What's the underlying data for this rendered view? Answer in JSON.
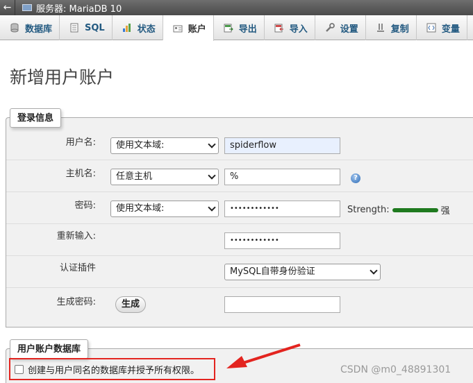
{
  "server_bar": {
    "back": "←",
    "label": "服务器: MariaDB 10"
  },
  "tabs": [
    {
      "label": "数据库",
      "icon": "database-icon",
      "active": false
    },
    {
      "label": "SQL",
      "icon": "sql-icon",
      "active": false
    },
    {
      "label": "状态",
      "icon": "status-icon",
      "active": false
    },
    {
      "label": "账户",
      "icon": "accounts-icon",
      "active": true
    },
    {
      "label": "导出",
      "icon": "export-icon",
      "active": false
    },
    {
      "label": "导入",
      "icon": "import-icon",
      "active": false
    },
    {
      "label": "设置",
      "icon": "settings-icon",
      "active": false
    },
    {
      "label": "复制",
      "icon": "replication-icon",
      "active": false
    },
    {
      "label": "变量",
      "icon": "variables-icon",
      "active": false
    }
  ],
  "page_title": "新增用户账户",
  "login_info": {
    "legend": "登录信息",
    "username": {
      "label": "用户名:",
      "mode": "使用文本域:",
      "value": "spiderflow"
    },
    "host": {
      "label": "主机名:",
      "mode": "任意主机",
      "value": "%"
    },
    "password": {
      "label": "密码:",
      "mode": "使用文本域:",
      "value": "••••••••••••",
      "strength_label": "Strength:",
      "strength_value": "强"
    },
    "retype": {
      "label": "重新输入:",
      "value": "••••••••••••"
    },
    "auth_plugin": {
      "label": "认证插件",
      "value": "MySQL自带身份验证"
    },
    "generate": {
      "label": "生成密码:",
      "button": "生成",
      "value": ""
    }
  },
  "user_db": {
    "legend": "用户账户数据库",
    "checkbox_label": "创建与用户同名的数据库并授予所有权限。"
  },
  "watermark": "CSDN @m0_48891301",
  "colors": {
    "link": "#235a81",
    "highlight": "#e3241f",
    "strength": "#1f7a1f"
  }
}
